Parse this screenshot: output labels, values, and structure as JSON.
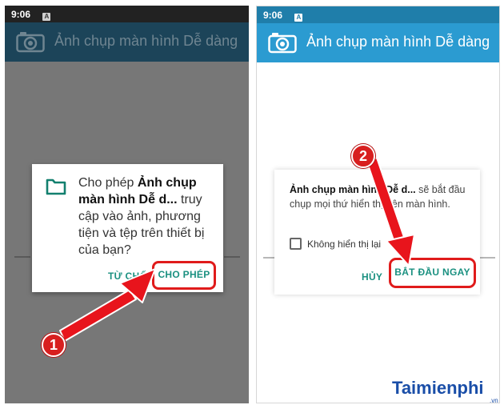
{
  "left_screen": {
    "status": {
      "time": "9:06",
      "notif_icon_label": "A"
    },
    "app_title": "Ảnh chụp màn hình Dễ dàng",
    "dialog": {
      "prefix": "Cho phép ",
      "app_name": "Ảnh chụp màn hình Dễ d...",
      "suffix": " truy cập vào ảnh, phương tiện và tệp trên thiết bị của bạn?",
      "deny_label": "TỪ CHỐI",
      "allow_label": "CHO PHÉP"
    },
    "step_number": "1"
  },
  "right_screen": {
    "status": {
      "time": "9:06",
      "notif_icon_label": "A"
    },
    "app_title": "Ảnh chụp màn hình Dễ dàng",
    "dialog": {
      "app_name": "Ảnh chụp màn hình Dễ d...",
      "suffix": " sẽ bắt đầu chụp mọi thứ hiển thị trên màn hình.",
      "checkbox_label": "Không hiển thị lại",
      "cancel_label": "HỦY",
      "start_label": "BẮT ĐẦU NGAY"
    },
    "step_number": "2"
  },
  "watermark": {
    "brand": "aimienphi",
    "brand_initial": "T",
    "suffix": ".vn"
  },
  "colors": {
    "accent_red": "#e01b1b",
    "button_teal": "#1a9080",
    "appbar_blue": "#2b9bd1"
  },
  "icons": [
    "camera-icon",
    "folder-icon",
    "notification-icon"
  ]
}
